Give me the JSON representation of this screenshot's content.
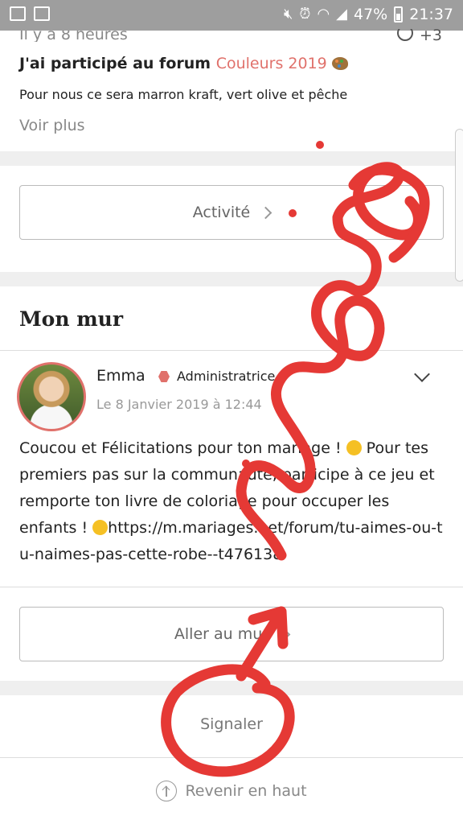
{
  "status_bar": {
    "battery": "47%",
    "time": "21:37"
  },
  "forum_post": {
    "time_ago": "Il y a 8 heures",
    "replies": "+3",
    "title_prefix": "J'ai participé au forum",
    "forum_link": "Couleurs 2019",
    "text": "Pour nous ce sera marron kraft, vert olive et pêche",
    "see_more": "Voir plus"
  },
  "activity_button": "Activité",
  "wall": {
    "title": "Mon mur",
    "post": {
      "author": "Emma",
      "role": "Administratrice",
      "date": "Le 8 Janvier 2019 à 12:44",
      "message_part1": "Coucou et Félicitations pour ton mariage ! ",
      "message_part2": " Pour tes premiers pas sur la communauté, participe à ce jeu et remporte ton livre de coloriage pour occuper les enfants ! ",
      "link": "https://m.mariages.net/forum/tu-aimes-ou-tu-naimes-pas-cette-robe--t476138"
    },
    "go_button": "Aller au mur"
  },
  "report": "Signaler",
  "back_to_top": "Revenir en haut",
  "colors": {
    "accent": "#e0716b",
    "annotation_red": "#e53935"
  }
}
